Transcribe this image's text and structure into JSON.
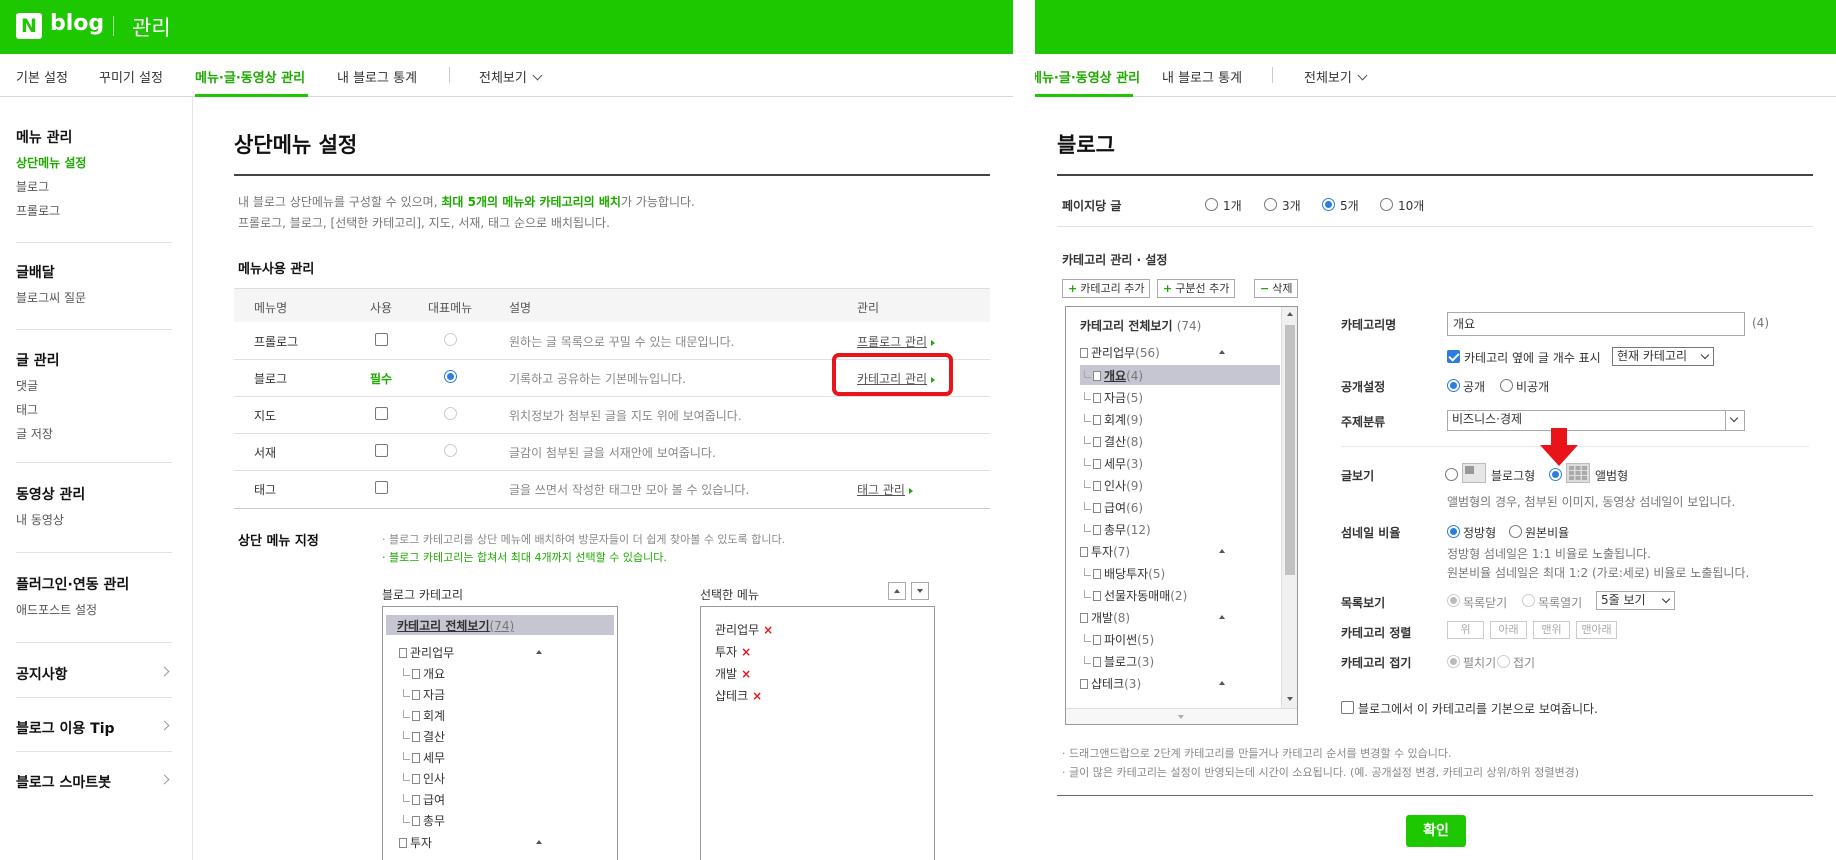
{
  "header": {
    "logo_n": "N",
    "logo_blog": "blog",
    "title": "관리"
  },
  "nav": {
    "basic": "기본 설정",
    "decor": "꾸미기 설정",
    "menu": "메뉴·글·동영상 관리",
    "stats": "내 블로그 통계",
    "all": "전체보기"
  },
  "sidebar": {
    "menu_manage": "메뉴 관리",
    "top_menu": "상단메뉴 설정",
    "blog": "블로그",
    "prologue": "프롤로그",
    "post_dispatch": "글배달",
    "blog_qna": "블로그씨 질문",
    "post_manage": "글 관리",
    "comments": "댓글",
    "tags": "태그",
    "post_save": "글 저장",
    "video_manage": "동영상 관리",
    "my_video": "내 동영상",
    "plugin": "플러그인·연동 관리",
    "adpost": "애드포스트 설정",
    "notice": "공지사항",
    "tips": "블로그 이용 Tip",
    "smartbot": "블로그 스마트봇"
  },
  "main_left": {
    "title": "상단메뉴 설정",
    "desc1_pre": "내 블로그 상단메뉴를 구성할 수 있으며, ",
    "desc1_hl": "최대 5개의 메뉴와 카테고리의 배치",
    "desc1_post": "가 가능합니다.",
    "desc2": "프롤로그, 블로그, [선택한 카테고리], 지도, 서재, 태그 순으로 배치됩니다.",
    "menu_use_title": "메뉴사용 관리",
    "headers": [
      "메뉴명",
      "사용",
      "대표메뉴",
      "설명",
      "관리"
    ],
    "rows": [
      {
        "name": "프롤로그",
        "desc": "원하는 글 목록으로 꾸밀 수 있는 대문입니다.",
        "manage": "프롤로그 관리"
      },
      {
        "name": "블로그",
        "required": "필수",
        "desc": "기록하고 공유하는 기본메뉴입니다.",
        "manage": "카테고리 관리"
      },
      {
        "name": "지도",
        "desc": "위치정보가 첨부된 글을 지도 위에 보여줍니다.",
        "manage": ""
      },
      {
        "name": "서재",
        "desc": "글감이 첨부된 글을 서재안에 보여줍니다.",
        "manage": ""
      },
      {
        "name": "태그",
        "desc": "글을 쓰면서 작성한 태그만 모아 볼 수 있습니다.",
        "manage": "태그 관리"
      }
    ],
    "top_menu_assign": "상단 메뉴 지정",
    "note1": "· 블로그 카테고리를 상단 메뉴에 배치하여 방문자들이 더 쉽게 찾아볼 수 있도록 합니다.",
    "note2": "· 블로그 카테고리는 합쳐서 최대 4개까지 선택할 수 있습니다.",
    "blog_category_label": "블로그 카테고리",
    "selected_menu_label": "선택한 메뉴",
    "tree_all": "카테고리 전체보기",
    "tree_all_count": "(74)",
    "tree": [
      "관리업무",
      "개요",
      "자금",
      "회계",
      "결산",
      "세무",
      "인사",
      "급여",
      "총무",
      "투자"
    ],
    "selected": [
      "관리업무",
      "투자",
      "개발",
      "샵테크"
    ],
    "x_mark": "×"
  },
  "main_right": {
    "title": "블로그",
    "per_page_label": "페이지당 글",
    "per_page_options": [
      "1개",
      "3개",
      "5개",
      "10개"
    ],
    "cat_manage_title": "카테고리 관리 · 설정",
    "add_category": "카테고리 추가",
    "add_divider": "구분선 추가",
    "delete": "삭제",
    "plus": "+",
    "minus": "−",
    "tree_all": "카테고리 전체보기",
    "tree_all_count": "(74)",
    "tree": [
      {
        "name": "관리업무",
        "count": "(56)"
      },
      {
        "name": "개요",
        "count": "(4)"
      },
      {
        "name": "자금",
        "count": "(5)"
      },
      {
        "name": "회계",
        "count": "(9)"
      },
      {
        "name": "결산",
        "count": "(8)"
      },
      {
        "name": "세무",
        "count": "(3)"
      },
      {
        "name": "인사",
        "count": "(9)"
      },
      {
        "name": "급여",
        "count": "(6)"
      },
      {
        "name": "총무",
        "count": "(12)"
      },
      {
        "name": "투자",
        "count": "(7)"
      },
      {
        "name": "배당투자",
        "count": "(5)"
      },
      {
        "name": "선물자동매매",
        "count": "(2)"
      },
      {
        "name": "개발",
        "count": "(8)"
      },
      {
        "name": "파이썬",
        "count": "(5)"
      },
      {
        "name": "블로그",
        "count": "(3)"
      },
      {
        "name": "샵테크",
        "count": "(3)"
      }
    ],
    "cat_name_label": "카테고리명",
    "cat_name_value": "개요",
    "cat_name_count": "(4)",
    "show_count_label": "카테고리 옆에 글 개수 표시",
    "count_select": "현재 카테고리",
    "public_label": "공개설정",
    "public": "공개",
    "private": "비공개",
    "topic_label": "주제분류",
    "topic_value": "비즈니스·경제",
    "view_label": "글보기",
    "blog_type": "블로그형",
    "album_type": "앨범형",
    "album_desc": "앨범형의 경우, 첨부된 이미지, 동영상 섬네일이 보입니다.",
    "thumb_label": "섬네일 비율",
    "square": "정방형",
    "original": "원본비율",
    "thumb_desc1": "정방형 섬네일은 1:1 비율로 노출됩니다.",
    "thumb_desc2": "원본비율 섬네일은 최대 1:2 (가로:세로) 비율로 노출됩니다.",
    "list_label": "목록보기",
    "list_close": "목록닫기",
    "list_open": "목록열기",
    "list_lines": "5줄 보기",
    "sort_label": "카테고리 정렬",
    "sort_buttons": [
      "위",
      "아래",
      "맨위",
      "맨아래"
    ],
    "fold_label": "카테고리 접기",
    "unfold": "펼치기",
    "fold": "접기",
    "default_cat": "블로그에서 이 카테고리를 기본으로 보여줍니다.",
    "note1": "· 드래그앤드랍으로 2단계 카테고리를 만들거나 카테고리 순서를 변경할 수 있습니다.",
    "note2": "· 글이 많은 카테고리는 설정이 반영되는데 시간이 소요됩니다. (예. 공개설정 변경, 카테고리 상위/하위 정렬변경)",
    "confirm": "확인"
  },
  "colors": {
    "brand_green": "#1ec800",
    "text_green": "#1eaa00",
    "highlight_red": "#e8141a",
    "radio_blue": "#2a7de1"
  }
}
